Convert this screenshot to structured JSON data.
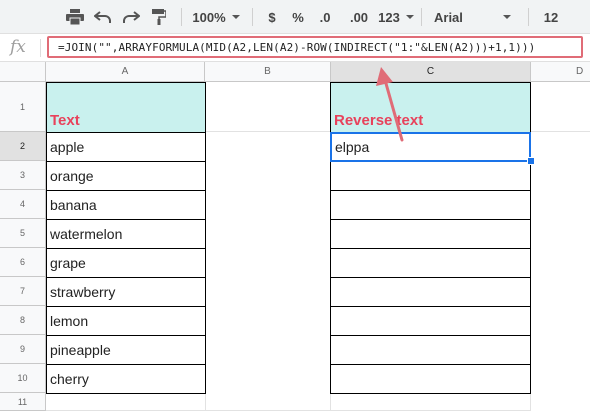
{
  "toolbar": {
    "print_icon": "print-icon",
    "undo_icon": "undo-icon",
    "redo_icon": "redo-icon",
    "paint_format_icon": "paint-format-icon",
    "zoom": "100%",
    "currency": "$",
    "percent": "%",
    "decrease_decimal": ".0",
    "increase_decimal": ".00",
    "more_formats": "123",
    "font": "Arial",
    "font_size": "12"
  },
  "formula_bar": {
    "fx_label": "fx",
    "formula": "=JOIN(\"\",ARRAYFORMULA(MID(A2,LEN(A2)-ROW(INDIRECT(\"1:\"&LEN(A2)))+1,1)))"
  },
  "columns": [
    "A",
    "B",
    "C",
    "D"
  ],
  "rows": [
    "1",
    "2",
    "3",
    "4",
    "5",
    "6",
    "7",
    "8",
    "9",
    "10",
    "11"
  ],
  "cells": {
    "a1": "Text",
    "c1": "Reverse text",
    "a_values": [
      "apple",
      "orange",
      "banana",
      "watermelon",
      "grape",
      "strawberry",
      "lemon",
      "pineapple",
      "cherry"
    ],
    "c2": "elppa"
  },
  "colors": {
    "header_fill": "#c9f1ee",
    "header_text": "#e8425b",
    "annotation": "#e06c77",
    "selection": "#1a73e8"
  }
}
